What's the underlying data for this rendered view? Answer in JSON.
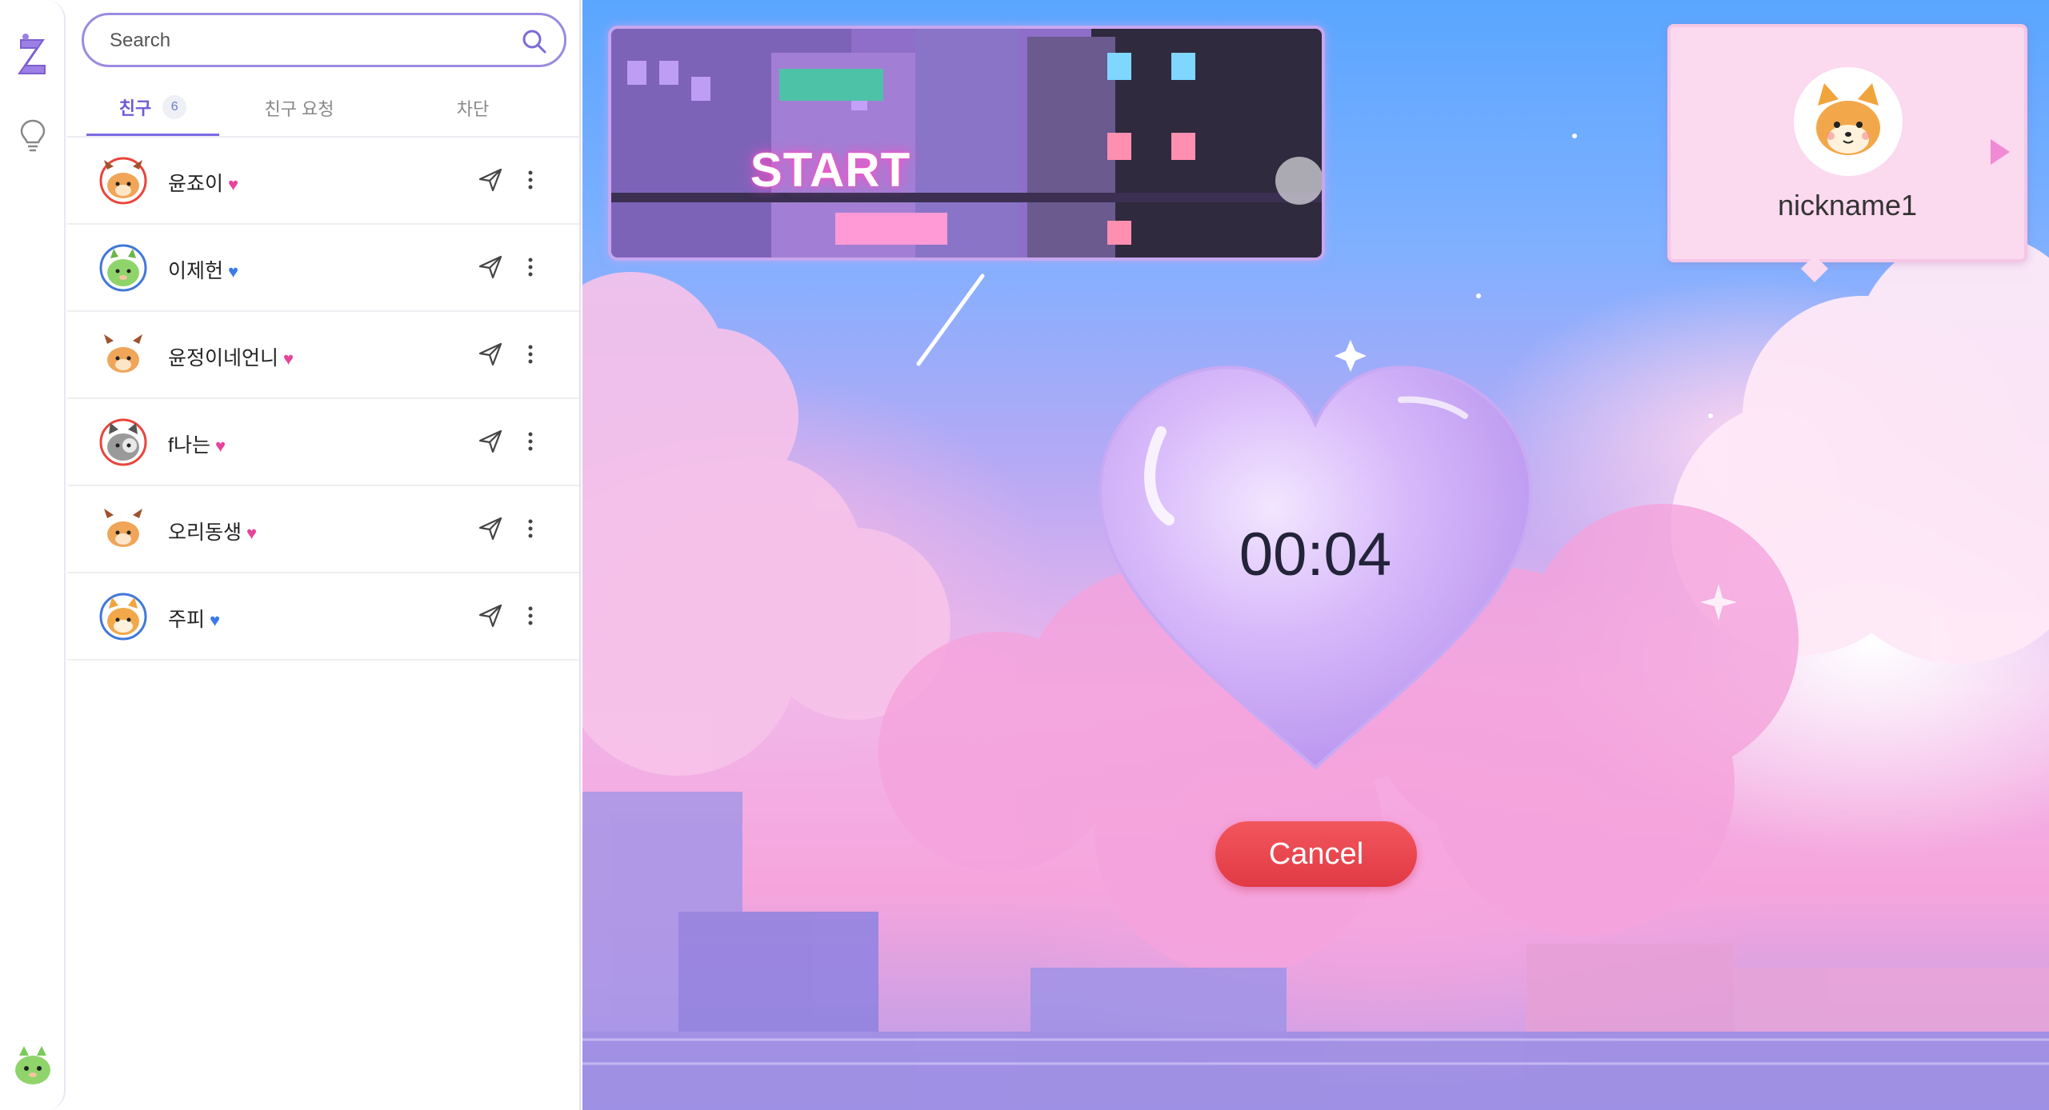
{
  "search": {
    "placeholder": "Search"
  },
  "tabs": {
    "friends_label": "친구",
    "friends_count": "6",
    "requests_label": "친구 요청",
    "blocked_label": "차단"
  },
  "friends": [
    {
      "name": "윤죠이",
      "heart": "♥",
      "heart_color": "#e8439a",
      "ring": "#e8453c",
      "animal": "deer"
    },
    {
      "name": "이제헌",
      "heart": "♥",
      "heart_color": "#3b7be8",
      "ring": "#4178d8",
      "animal": "dino"
    },
    {
      "name": "윤정이네언니",
      "heart": "♥",
      "heart_color": "#e8439a",
      "ring": "none",
      "animal": "deer"
    },
    {
      "name": "f나는",
      "heart": "♥",
      "heart_color": "#e8439a",
      "ring": "#e8453c",
      "animal": "cat"
    },
    {
      "name": "오리동생",
      "heart": "♥",
      "heart_color": "#e8439a",
      "ring": "none",
      "animal": "deer"
    },
    {
      "name": "주피",
      "heart": "♥",
      "heart_color": "#3b7be8",
      "ring": "#4178d8",
      "animal": "shiba"
    }
  ],
  "game": {
    "banner_text": "START",
    "opponent_name": "nickname1",
    "timer": "00:04",
    "cancel_label": "Cancel"
  },
  "colors": {
    "accent": "#7b6be3",
    "cancel": "#e8434b",
    "pink_heart": "#e8439a",
    "blue_heart": "#3b7be8"
  },
  "icons": [
    "z-logo-icon",
    "lightbulb-icon",
    "search-icon",
    "send-icon",
    "more-vertical-icon",
    "play-arrow-icon"
  ]
}
